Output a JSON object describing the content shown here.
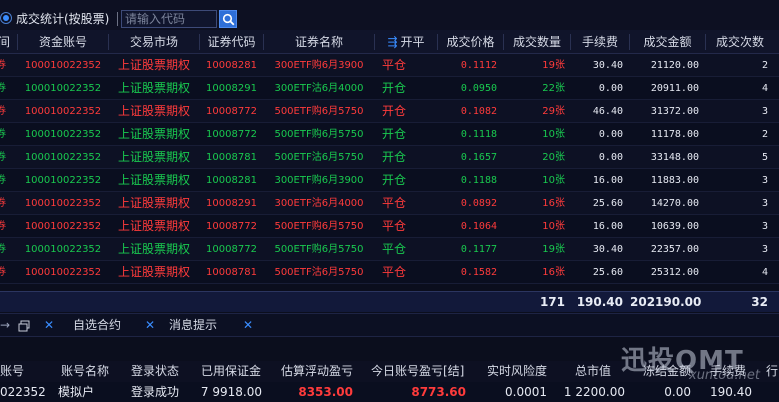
{
  "toolbar": {
    "title": "成交统计(按股票)",
    "search_placeholder": "请输入代码"
  },
  "columns": [
    "间",
    "资金账号",
    "交易市场",
    "证券代码",
    "证券名称",
    "开平",
    "成交价格",
    "成交数量",
    "手续费",
    "成交金额",
    "成交次数"
  ],
  "rows": [
    {
      "side": "buy",
      "account": "100010022352",
      "market": "上证股票期权",
      "code": "10008281",
      "name": "300ETF购6月3900",
      "op": "平仓",
      "price": "0.1112",
      "qty": "19张",
      "fee": "30.40",
      "amount": "21120.00",
      "count": "2"
    },
    {
      "side": "sell",
      "account": "100010022352",
      "market": "上证股票期权",
      "code": "10008291",
      "name": "300ETF沽6月4000",
      "op": "开仓",
      "price": "0.0950",
      "qty": "22张",
      "fee": "0.00",
      "amount": "20911.00",
      "count": "4"
    },
    {
      "side": "buy",
      "account": "100010022352",
      "market": "上证股票期权",
      "code": "10008772",
      "name": "500ETF购6月5750",
      "op": "开仓",
      "price": "0.1082",
      "qty": "29张",
      "fee": "46.40",
      "amount": "31372.00",
      "count": "3"
    },
    {
      "side": "sell",
      "account": "100010022352",
      "market": "上证股票期权",
      "code": "10008772",
      "name": "500ETF购6月5750",
      "op": "开仓",
      "price": "0.1118",
      "qty": "10张",
      "fee": "0.00",
      "amount": "11178.00",
      "count": "2"
    },
    {
      "side": "sell",
      "account": "100010022352",
      "market": "上证股票期权",
      "code": "10008781",
      "name": "500ETF沽6月5750",
      "op": "开仓",
      "price": "0.1657",
      "qty": "20张",
      "fee": "0.00",
      "amount": "33148.00",
      "count": "5"
    },
    {
      "side": "sell",
      "account": "100010022352",
      "market": "上证股票期权",
      "code": "10008281",
      "name": "300ETF购6月3900",
      "op": "开仓",
      "price": "0.1188",
      "qty": "10张",
      "fee": "16.00",
      "amount": "11883.00",
      "count": "3"
    },
    {
      "side": "buy",
      "account": "100010022352",
      "market": "上证股票期权",
      "code": "10008291",
      "name": "300ETF沽6月4000",
      "op": "平仓",
      "price": "0.0892",
      "qty": "16张",
      "fee": "25.60",
      "amount": "14270.00",
      "count": "3"
    },
    {
      "side": "buy",
      "account": "100010022352",
      "market": "上证股票期权",
      "code": "10008772",
      "name": "500ETF购6月5750",
      "op": "平仓",
      "price": "0.1064",
      "qty": "10张",
      "fee": "16.00",
      "amount": "10639.00",
      "count": "3"
    },
    {
      "side": "sell",
      "account": "100010022352",
      "market": "上证股票期权",
      "code": "10008772",
      "name": "500ETF购6月5750",
      "op": "平仓",
      "price": "0.1177",
      "qty": "19张",
      "fee": "30.40",
      "amount": "22357.00",
      "count": "3"
    },
    {
      "side": "buy",
      "account": "100010022352",
      "market": "上证股票期权",
      "code": "10008781",
      "name": "500ETF沽6月5750",
      "op": "平仓",
      "price": "0.1582",
      "qty": "16张",
      "fee": "25.60",
      "amount": "25312.00",
      "count": "4"
    }
  ],
  "totals": {
    "qty": "171",
    "fee": "190.40",
    "amount": "202190.00",
    "count": "32"
  },
  "tabs": [
    "自选合约",
    "消息提示"
  ],
  "account_table": {
    "columns": [
      "账号",
      "账号名称",
      "登录状态",
      "已用保证金",
      "估算浮动盈亏",
      "今日账号盈亏[结]",
      "实时风险度",
      "总市值",
      "冻结金额",
      "手续费",
      "行"
    ],
    "row": {
      "account": "022352",
      "name": "模拟户",
      "status": "登录成功",
      "margin": "7 9918.00",
      "float_pnl": "8353.00",
      "today_pnl": "8773.60",
      "risk": "0.0001",
      "market_value": "1 2200.00",
      "frozen": "0.00",
      "fee": "190.40"
    }
  },
  "watermark": {
    "brand": "迅投QMT",
    "url": "xuntou.net"
  },
  "colors": {
    "buy": "#ff3b3b",
    "sell": "#19c94f",
    "accent": "#3a8dff",
    "background": "#0b0e1d"
  }
}
